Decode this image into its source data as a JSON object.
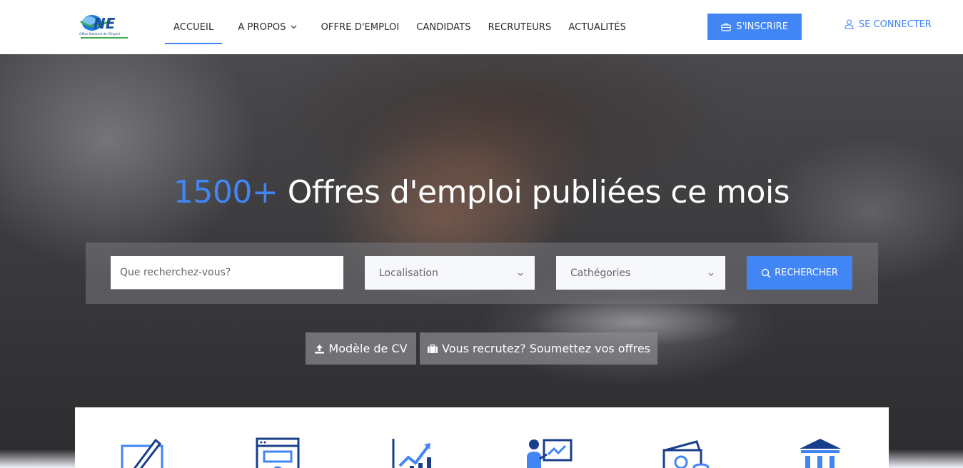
{
  "logo": {
    "text": "ONE",
    "subtitle": "Office National de l'Emploi"
  },
  "nav": {
    "items": [
      {
        "label": "ACCUEIL",
        "active": true
      },
      {
        "label": "A PROPOS",
        "has_dropdown": true
      },
      {
        "label": "OFFRE D'EMPLOI"
      },
      {
        "label": "CANDIDATS"
      },
      {
        "label": "RECRUTEURS"
      },
      {
        "label": "ACTUALITÉS"
      }
    ]
  },
  "header_actions": {
    "signup_label": "S'INSCRIRE",
    "login_label": "SE CONNECTER"
  },
  "hero": {
    "count": "1500+",
    "title_rest": " Offres d'emploi publiées ce mois"
  },
  "search": {
    "keyword_placeholder": "Que recherchez-vous?",
    "location_value": "Localisation",
    "category_value": "Cathégories",
    "submit_label": "RECHERCHER"
  },
  "hero_actions": {
    "cv_label": "Modèle de CV",
    "offer_label": "Vous recrutez? Soumettez vos offres"
  },
  "features": {
    "icons": [
      "edit-icon",
      "browser-settings-icon",
      "growth-chart-icon",
      "presentation-icon",
      "money-icon",
      "bank-icon"
    ]
  },
  "colors": {
    "accent": "#4285f4",
    "text": "#2b2b2b",
    "logo_green": "#3cab4a"
  }
}
